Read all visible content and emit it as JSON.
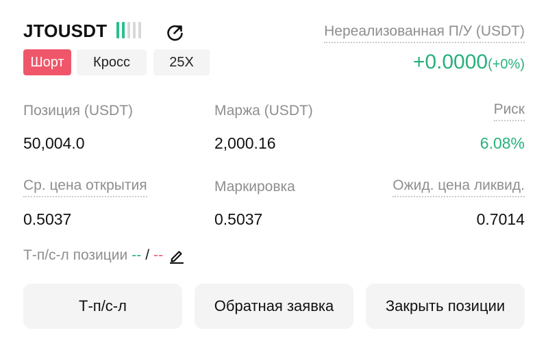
{
  "header": {
    "symbol": "JTOUSDT",
    "leverage_bars": {
      "filled": 2,
      "total": 5
    },
    "share_icon": "share-icon",
    "tags": {
      "side": "Шорт",
      "margin_mode": "Кросс",
      "leverage": "25X"
    },
    "colors": {
      "short": "#f0566a",
      "profit": "#27b07c"
    }
  },
  "pnl": {
    "label": "Нереализованная П/У (USDT)",
    "value": "+0.0000",
    "percent": "(+0%)"
  },
  "stats": {
    "position_label": "Позиция (USDT)",
    "position_value": "50,004.0",
    "margin_label": "Маржа (USDT)",
    "margin_value": "2,000.16",
    "risk_label": "Риск",
    "risk_value": "6.08%",
    "avg_open_label": "Ср. цена открытия",
    "avg_open_value": "0.5037",
    "mark_label": "Маркировка",
    "mark_value": "0.5037",
    "liq_label": "Ожид. цена ликвид.",
    "liq_value": "0.7014"
  },
  "tpsl": {
    "label": "Т-п/с-л позиции",
    "tp_value": "--",
    "separator": "/",
    "sl_value": "--",
    "edit_icon": "pencil-icon"
  },
  "buttons": {
    "tpsl": "Т-п/с-л",
    "reverse": "Обратная заявка",
    "close": "Закрыть позиции"
  }
}
